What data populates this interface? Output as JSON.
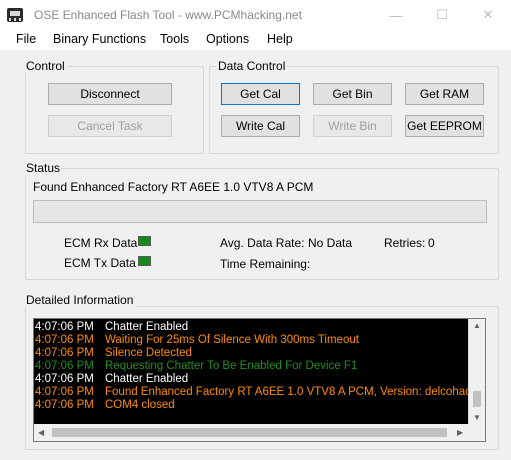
{
  "window": {
    "title": "OSE Enhanced Flash Tool - www.PCMhacking.net",
    "minimize_glyph": "—",
    "maximize_glyph": "☐",
    "close_glyph": "✕"
  },
  "menu": [
    "File",
    "Binary Functions",
    "Tools",
    "Options",
    "Help"
  ],
  "control": {
    "label": "Control",
    "disconnect": "Disconnect",
    "cancel_task": "Cancel Task"
  },
  "data_control": {
    "label": "Data Control",
    "get_cal": "Get Cal",
    "get_bin": "Get Bin",
    "get_ram": "Get RAM",
    "write_cal": "Write Cal",
    "write_bin": "Write Bin",
    "get_eeprom": "Get EEPROM"
  },
  "status": {
    "label": "Status",
    "message": "Found Enhanced Factory RT A6EE 1.0 VTV8 A PCM",
    "progress": 0,
    "ecm_rx_label": "ECM Rx Data",
    "ecm_tx_label": "ECM Tx Data",
    "avg_rate_label": "Avg. Data Rate:",
    "avg_rate_value": "No Data",
    "retries_label": "Retries:",
    "retries_value": "0",
    "time_remaining_label": "Time Remaining:",
    "led_color": "#138a1a"
  },
  "detail": {
    "label": "Detailed Information",
    "rows": [
      {
        "time": "4:07:06 PM",
        "text": "Chatter Enabled",
        "color": "#ffffff"
      },
      {
        "time": "4:07:06 PM",
        "text": "Waiting For 25ms Of Silence With 300ms Timeout",
        "color": "#ff8c00"
      },
      {
        "time": "4:07:06 PM",
        "text": "Silence Detected",
        "color": "#ff8c00"
      },
      {
        "time": "4:07:06 PM",
        "text": "Requesting Chatter To Be Enabled For Device F1",
        "color": "#1f8f1f"
      },
      {
        "time": "4:07:06 PM",
        "text": "Chatter Enabled",
        "color": "#ffffff"
      },
      {
        "time": "4:07:06 PM",
        "text": "Found Enhanced Factory RT A6EE 1.0 VTV8 A PCM, Version: delcohacking",
        "color": "#ff8c00"
      },
      {
        "time": "4:07:06 PM",
        "text": "COM4 closed",
        "color": "#ff8c00"
      }
    ]
  },
  "colors": {
    "window_bg": "#f0f0f0",
    "log_bg": "#000000",
    "accent": "#0078d7",
    "led_green": "#138a1a"
  }
}
